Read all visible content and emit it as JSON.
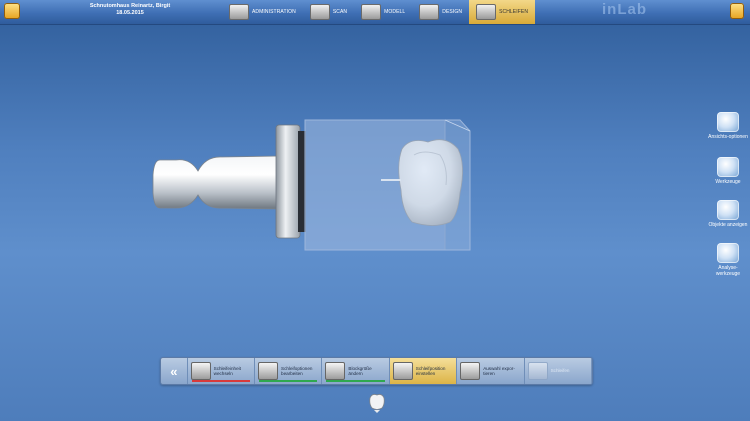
{
  "header": {
    "patient_name": "Schnutomhaus Reinartz, Birgit",
    "date": "18.05.2015",
    "brand": "inLab"
  },
  "phases": [
    {
      "label": "ADMINISTRATION",
      "icon": "administration-icon",
      "active": false
    },
    {
      "label": "SCAN",
      "icon": "scan-icon",
      "active": false
    },
    {
      "label": "MODELL",
      "icon": "model-icon",
      "active": false
    },
    {
      "label": "DESIGN",
      "icon": "design-icon",
      "active": false
    },
    {
      "label": "SCHLEIFEN",
      "icon": "grinding-icon",
      "active": true
    }
  ],
  "side_tools": [
    {
      "label": "Ansichts-optionen",
      "icon": "view-options-icon"
    },
    {
      "label": "Werkzeuge",
      "icon": "tools-icon"
    },
    {
      "label": "Objekte anzeigen",
      "icon": "show-objects-icon"
    },
    {
      "label": "Analyse-werkzeuge",
      "icon": "analysis-tools-icon"
    }
  ],
  "bottom_toolbar": [
    {
      "label": "Schleifeinheit wechseln",
      "icon": "grinding-unit-icon",
      "underline": "#d83a3a",
      "active": false,
      "enabled": true
    },
    {
      "label": "Schleifoptionen bearbeiten",
      "icon": "grinding-options-icon",
      "underline": "#2fa84f",
      "active": false,
      "enabled": true
    },
    {
      "label": "Blockgröße ändern",
      "icon": "block-size-icon",
      "underline": "#2fa84f",
      "active": false,
      "enabled": true
    },
    {
      "label": "Schleifposition einstellen",
      "icon": "grinding-position-icon",
      "underline": "",
      "active": true,
      "enabled": true
    },
    {
      "label": "Auswahl expor-tieren",
      "icon": "export-icon",
      "underline": "",
      "active": false,
      "enabled": true
    },
    {
      "label": "Schleifen",
      "icon": "grind-icon",
      "underline": "",
      "active": false,
      "enabled": false
    }
  ],
  "colors": {
    "background": "#4f7fbe",
    "active_phase": "#e2b64a"
  }
}
